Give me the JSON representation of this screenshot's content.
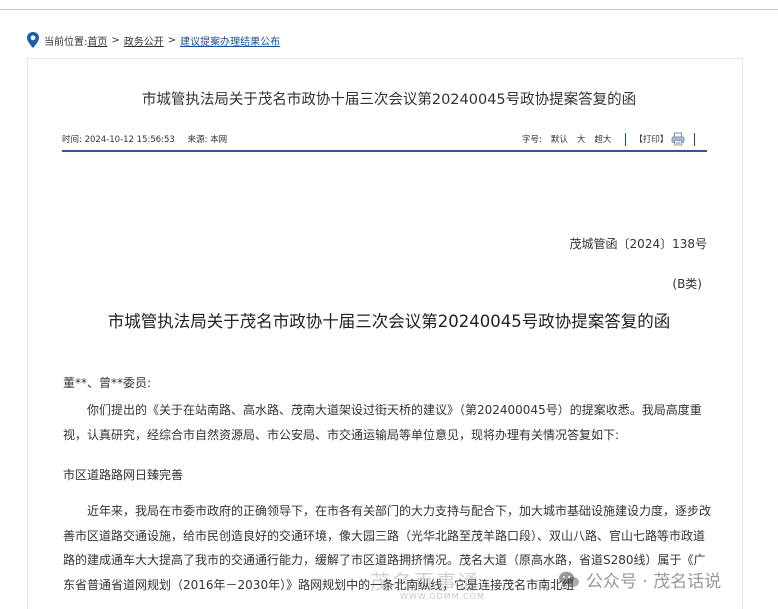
{
  "breadcrumb": {
    "prefix": "当前位置:",
    "items": [
      "首页",
      "政务公开",
      "建议提案办理结果公布"
    ],
    "separator": ">"
  },
  "page_title": "市城管执法局关于茂名市政协十届三次会议第20240045号政协提案答复的函",
  "meta": {
    "time": "时间: 2024-10-12 15:56:53",
    "source": "来源: 本网"
  },
  "tools": {
    "font_label": "字号:",
    "sizes": [
      "默认",
      "大",
      "超大"
    ],
    "print": "【打印】"
  },
  "document": {
    "number": "茂城管函〔2024〕138号",
    "classification": "(B类)",
    "heading": "市城管执法局关于茂名市政协十届三次会议第20240045号政协提案答复的函",
    "salutation": "董**、曾**委员:",
    "body1": "你们提出的《关于在站南路、高水路、茂南大道架设过街天桥的建议》（第202400045号）的提案收悉。我局高度重视，认真研究，经综合市自然资源局、市公安局、市交通运输局等单位意见，现将办理有关情况答复如下:",
    "subheading": "市区道路路网日臻完善",
    "body2": "近年来，我局在市委市政府的正确领导下，在市各有关部门的大力支持与配合下，加大城市基础设施建设力度，逐步改善市区道路交通设施，给市民创造良好的交通环境，像大园三路（光华北路至茂羊路口段）、双山八路、官山七路等市政道路的建成通车大大提高了我市的交通通行能力，缓解了市区道路拥挤情况。茂名大道（原高水路，省道S280线）属于《广东省普通省道网规划（2016年－2030年）》路网规划中的一条北南纵线，它是连接茂名市南北组"
  },
  "watermark": {
    "text": "茂名百事通",
    "url": "WWW.GDMM.COM",
    "brand": "公众号 · 茂名话说"
  },
  "colors": {
    "link": "#1a4e9c",
    "rule": "#2a5a9e",
    "pin": "#1d5fa8"
  }
}
